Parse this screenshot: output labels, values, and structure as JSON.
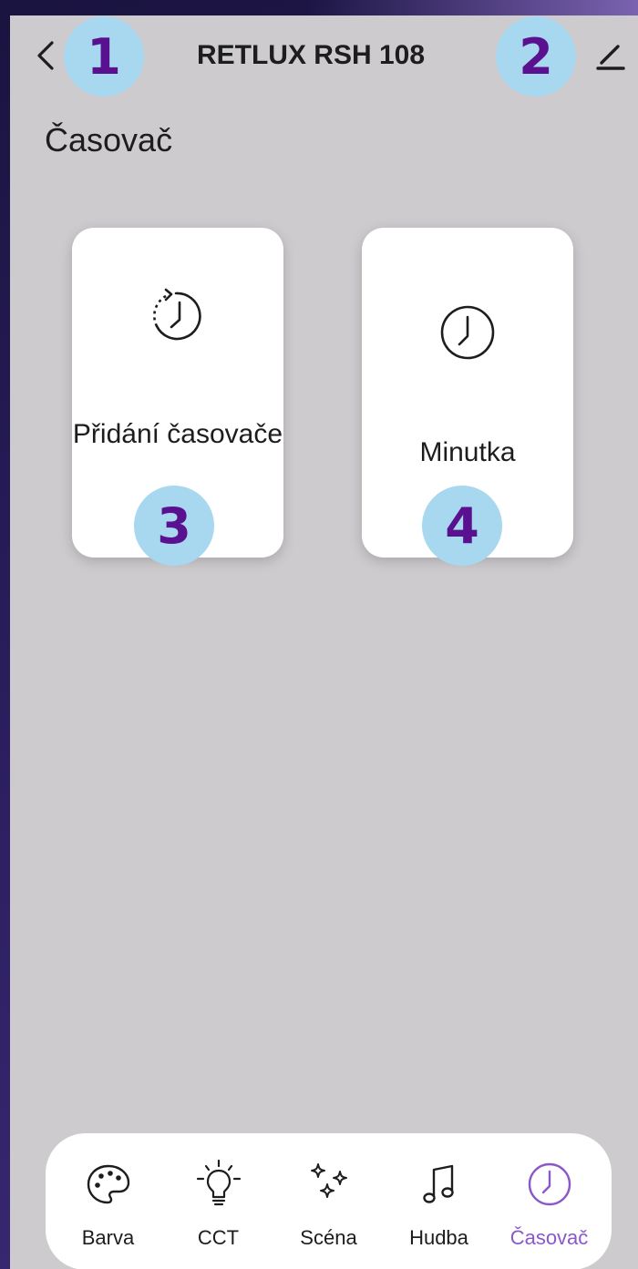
{
  "header": {
    "title": "RETLUX RSH 108",
    "back_icon": "chevron-left-icon",
    "edit_icon": "pencil-icon"
  },
  "section": {
    "title": "Časovač"
  },
  "cards": [
    {
      "label": "Přidání časovače",
      "icon": "timer-add-icon"
    },
    {
      "label": "Minutka",
      "icon": "clock-icon"
    }
  ],
  "badges": [
    "1",
    "2",
    "3",
    "4"
  ],
  "nav": {
    "items": [
      {
        "label": "Barva",
        "icon": "palette-icon"
      },
      {
        "label": "CCT",
        "icon": "lightbulb-icon"
      },
      {
        "label": "Scéna",
        "icon": "sparkles-icon"
      },
      {
        "label": "Hudba",
        "icon": "music-note-icon"
      },
      {
        "label": "Časovač",
        "icon": "clock-icon",
        "active": true
      }
    ]
  },
  "colors": {
    "accent": "#8b58c9",
    "badge_bg": "#a8d7f0",
    "badge_text": "#5a1190",
    "screen_bg": "#cdcbce",
    "card_bg": "#ffffff"
  }
}
